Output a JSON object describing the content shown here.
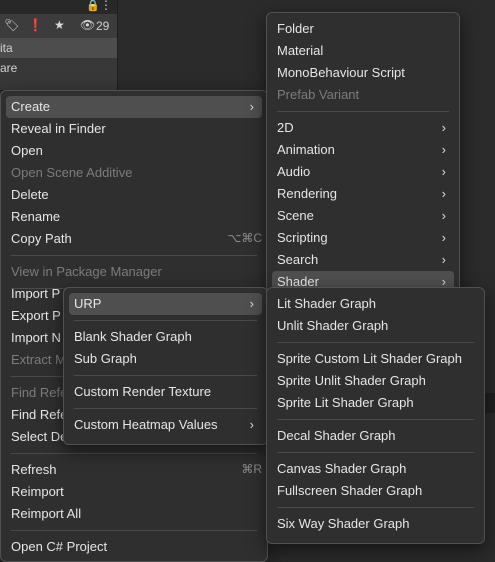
{
  "project_toolbar": {
    "lock_icon": "lock-icon",
    "more_icon": "more-dots-icon",
    "tag_icon": "tag-icon",
    "warning_icon": "warning-icon",
    "star_icon": "star-icon",
    "eye_icon": "eye-icon",
    "hidden_count": "29"
  },
  "asset_list": {
    "selected_item_fragment": "ita",
    "item_fragment": "are"
  },
  "context_menu": {
    "items": [
      {
        "label": "Create",
        "submenu": true,
        "highlighted": true
      },
      {
        "label": "Reveal in Finder"
      },
      {
        "label": "Open"
      },
      {
        "label": "Open Scene Additive",
        "disabled": true
      },
      {
        "label": "Delete"
      },
      {
        "label": "Rename"
      },
      {
        "label": "Copy Path",
        "shortcut": "⌥⌘C"
      },
      {
        "label": "View in Package Manager",
        "disabled": true
      },
      {
        "label": "Import P"
      },
      {
        "label": "Export P"
      },
      {
        "label": "Import N"
      },
      {
        "label": "Extract M",
        "disabled": true
      },
      {
        "label": "Find Refe",
        "disabled": true
      },
      {
        "label": "Find Refe"
      },
      {
        "label": "Select De"
      },
      {
        "label": "Refresh",
        "shortcut": "⌘R"
      },
      {
        "label": "Reimport"
      },
      {
        "label": "Reimport All"
      },
      {
        "label": "Open C# Project"
      }
    ]
  },
  "create_submenu": {
    "items": [
      {
        "label": "Folder"
      },
      {
        "label": "Material"
      },
      {
        "label": "MonoBehaviour Script"
      },
      {
        "label": "Prefab Variant",
        "disabled": true
      },
      {
        "label": "2D",
        "submenu": true
      },
      {
        "label": "Animation",
        "submenu": true
      },
      {
        "label": "Audio",
        "submenu": true
      },
      {
        "label": "Rendering",
        "submenu": true
      },
      {
        "label": "Scene",
        "submenu": true
      },
      {
        "label": "Scripting",
        "submenu": true
      },
      {
        "label": "Search",
        "submenu": true
      },
      {
        "label": "Shader",
        "submenu": true,
        "highlighted": true
      }
    ]
  },
  "shader_submenu": {
    "items": [
      {
        "label": "URP",
        "submenu": true,
        "highlighted": true
      },
      {
        "label": "Blank Shader Graph"
      },
      {
        "label": "Sub Graph"
      },
      {
        "label": "Custom Render Texture"
      },
      {
        "label": "Custom Heatmap Values",
        "submenu": true
      }
    ]
  },
  "urp_submenu": {
    "items": [
      {
        "label": "Lit Shader Graph"
      },
      {
        "label": "Unlit Shader Graph"
      },
      {
        "label": "Sprite Custom Lit Shader Graph"
      },
      {
        "label": "Sprite Unlit Shader Graph"
      },
      {
        "label": "Sprite Lit Shader Graph"
      },
      {
        "label": "Decal Shader Graph"
      },
      {
        "label": "Canvas Shader Graph"
      },
      {
        "label": "Fullscreen Shader Graph"
      },
      {
        "label": "Six Way Shader Graph"
      }
    ]
  }
}
